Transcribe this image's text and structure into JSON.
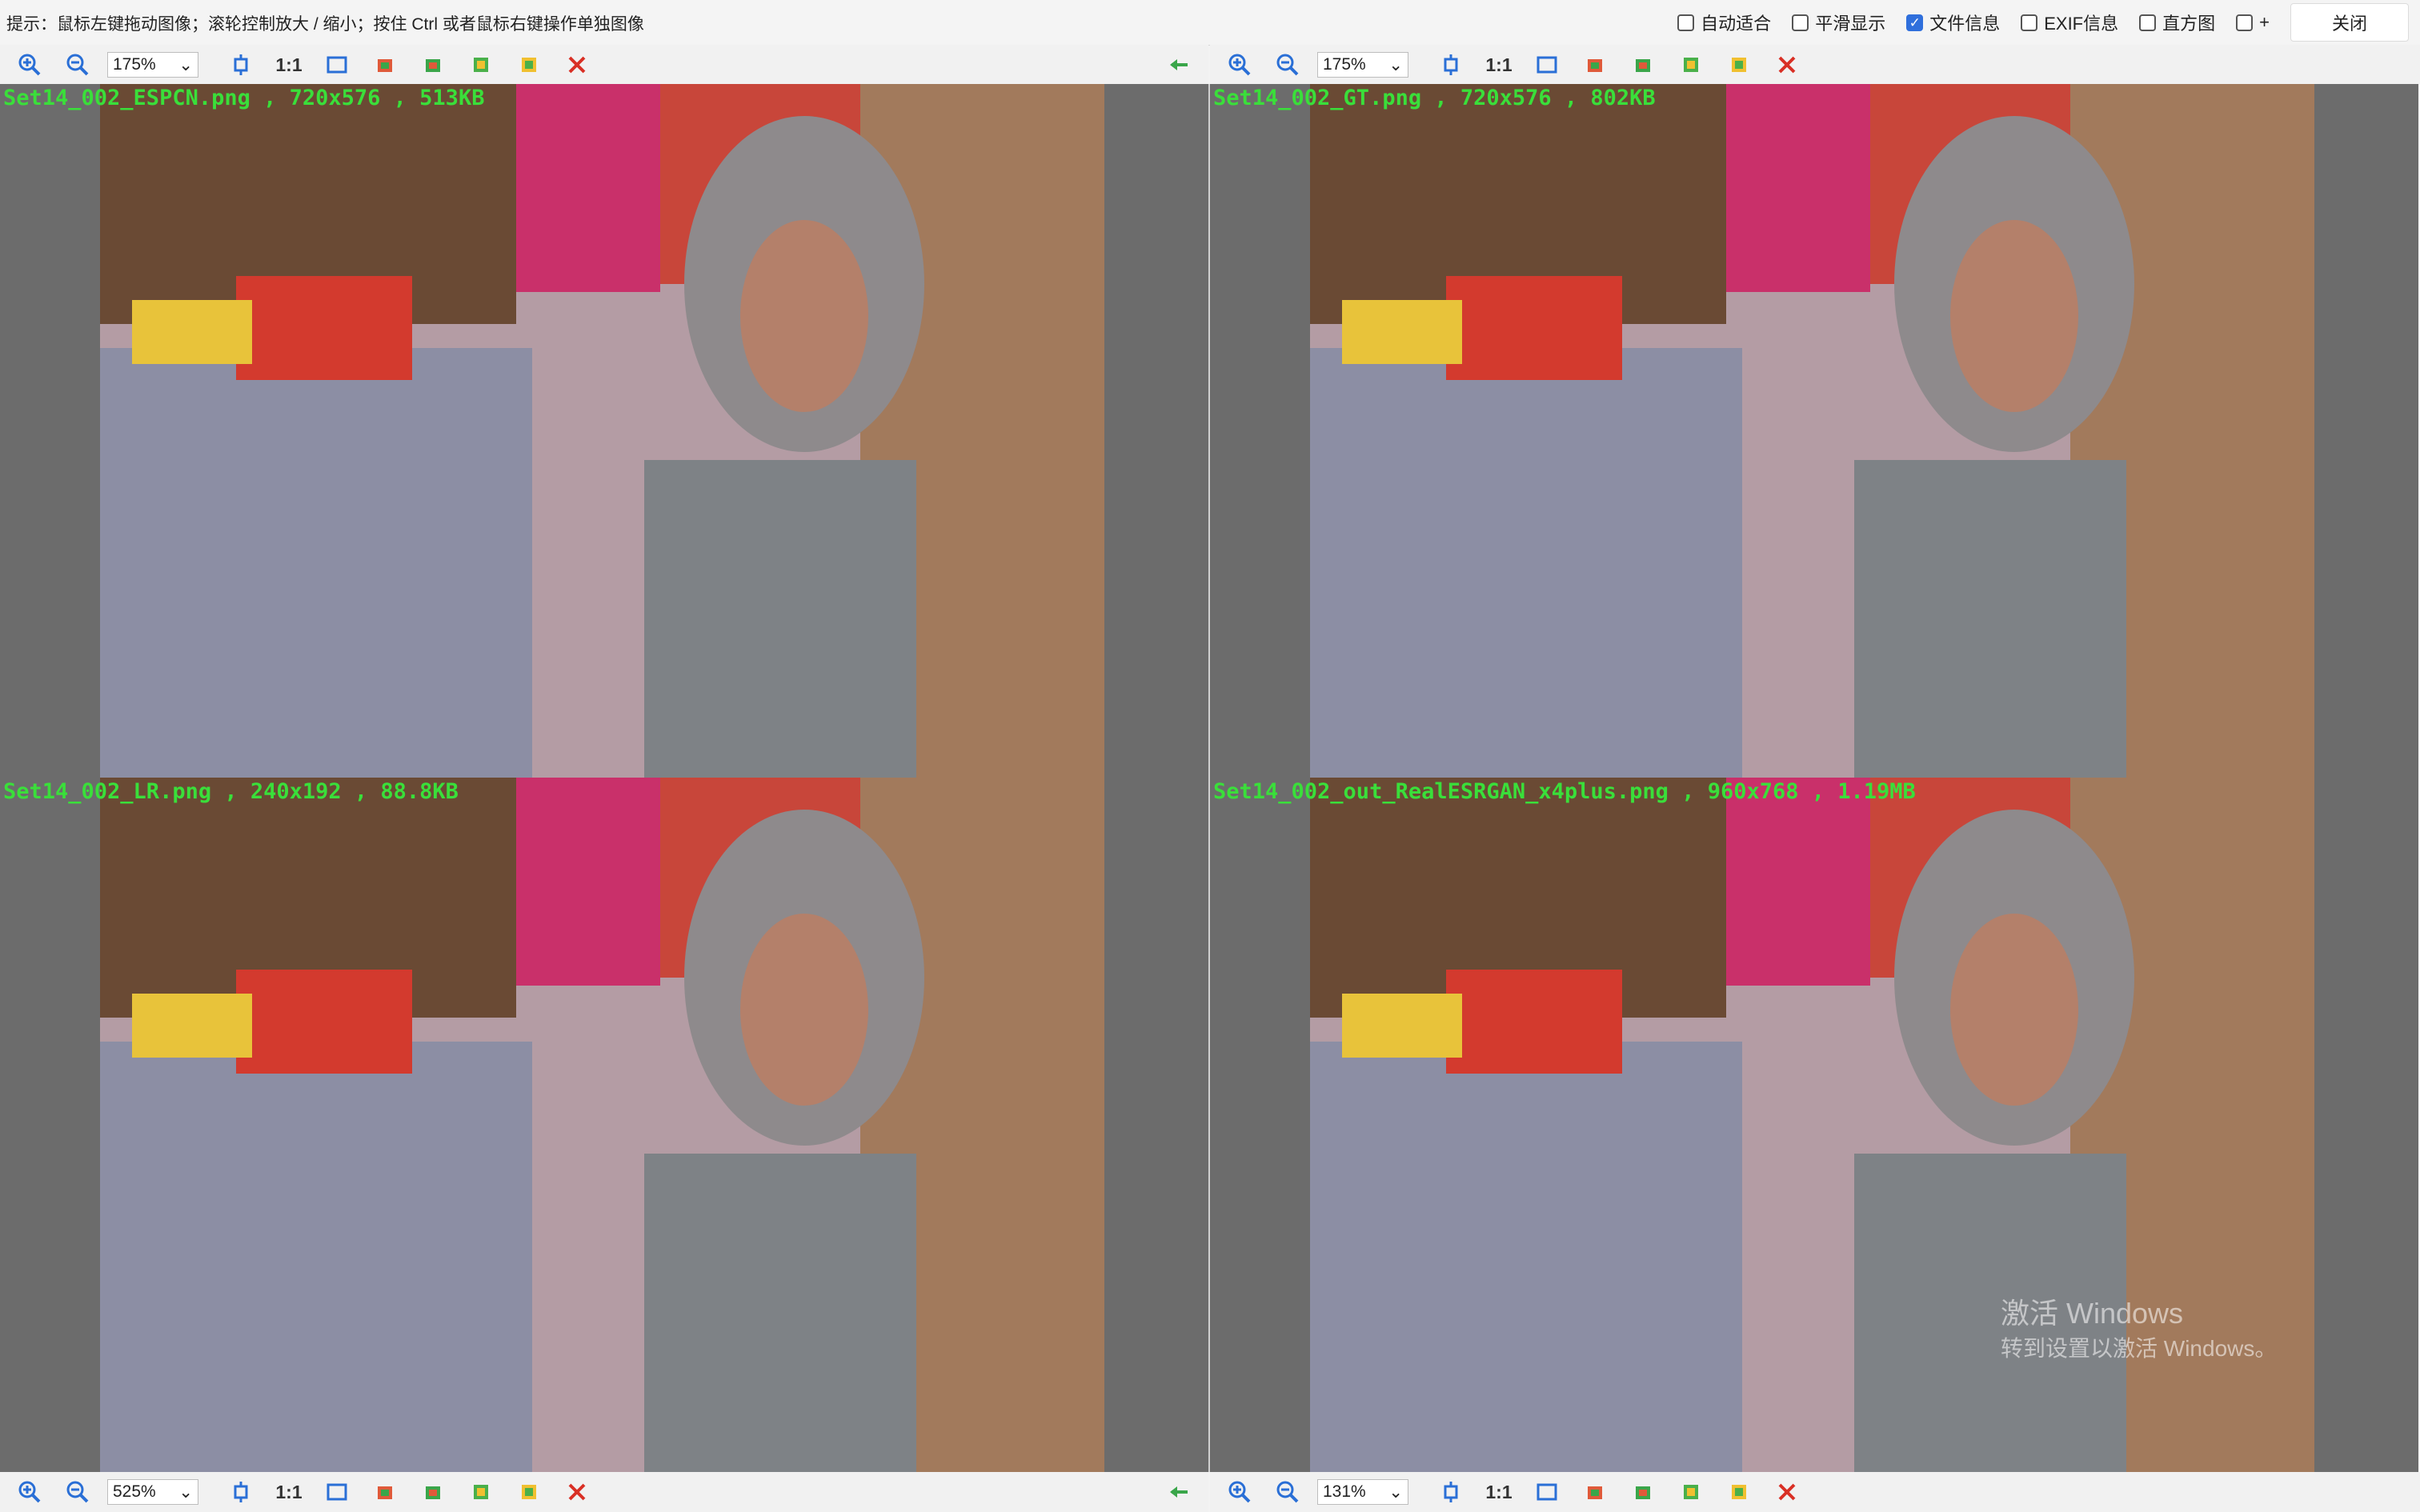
{
  "topbar": {
    "hint": "提示：鼠标左键拖动图像；滚轮控制放大 / 缩小；按住 Ctrl 或者鼠标右键操作单独图像",
    "options": [
      {
        "label": "自动适合",
        "checked": false
      },
      {
        "label": "平滑显示",
        "checked": false
      },
      {
        "label": "文件信息",
        "checked": true
      },
      {
        "label": "EXIF信息",
        "checked": false
      },
      {
        "label": "直方图",
        "checked": false
      },
      {
        "label": "+",
        "checked": false
      }
    ],
    "close_label": "关闭"
  },
  "toolbars": [
    {
      "zoom": "175%"
    },
    {
      "zoom": "175%"
    },
    {
      "zoom": "525%"
    },
    {
      "zoom": "131%"
    }
  ],
  "panes": [
    {
      "caption": "Set14_002_ESPCN.png , 720x576 , 513KB"
    },
    {
      "caption": "Set14_002_GT.png , 720x576 , 802KB"
    },
    {
      "caption": "Set14_002_LR.png , 240x192 , 88.8KB"
    },
    {
      "caption": "Set14_002_out_RealESRGAN_x4plus.png , 960x768 , 1.19MB"
    }
  ],
  "toolbar_labels": {
    "one_to_one": "1:1"
  },
  "watermark": {
    "line1": "激活 Windows",
    "line2": "转到设置以激活 Windows。"
  }
}
